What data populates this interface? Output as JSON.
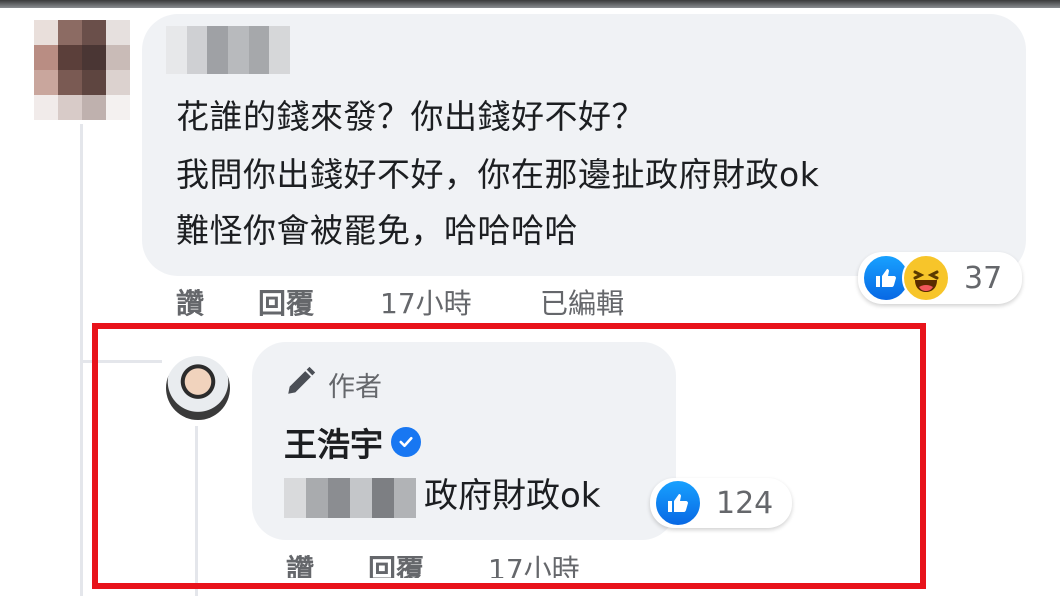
{
  "comment": {
    "lines": [
      "花誰的錢來發？你出錢好不好？",
      "我問你出錢好不好，你在那邊扯政府財政ok",
      "難怪你會被罷免，哈哈哈哈"
    ],
    "reaction_count": "37",
    "reactions": [
      "like-icon",
      "haha-icon"
    ],
    "actions": {
      "like": "讚",
      "reply": "回覆",
      "time": "17小時",
      "edited": "已編輯"
    }
  },
  "reply": {
    "author_badge": "作者",
    "author_name": "王浩宇",
    "verified": true,
    "text": "政府財政ok",
    "reaction_count": "124",
    "reactions": [
      "like-icon"
    ],
    "actions": {
      "like": "讚",
      "reply": "回覆",
      "time": "17小時"
    }
  },
  "colors": {
    "highlight": "#e8131b",
    "bubble": "#f0f2f5",
    "like": "#1877f2",
    "meta": "#65676b"
  }
}
